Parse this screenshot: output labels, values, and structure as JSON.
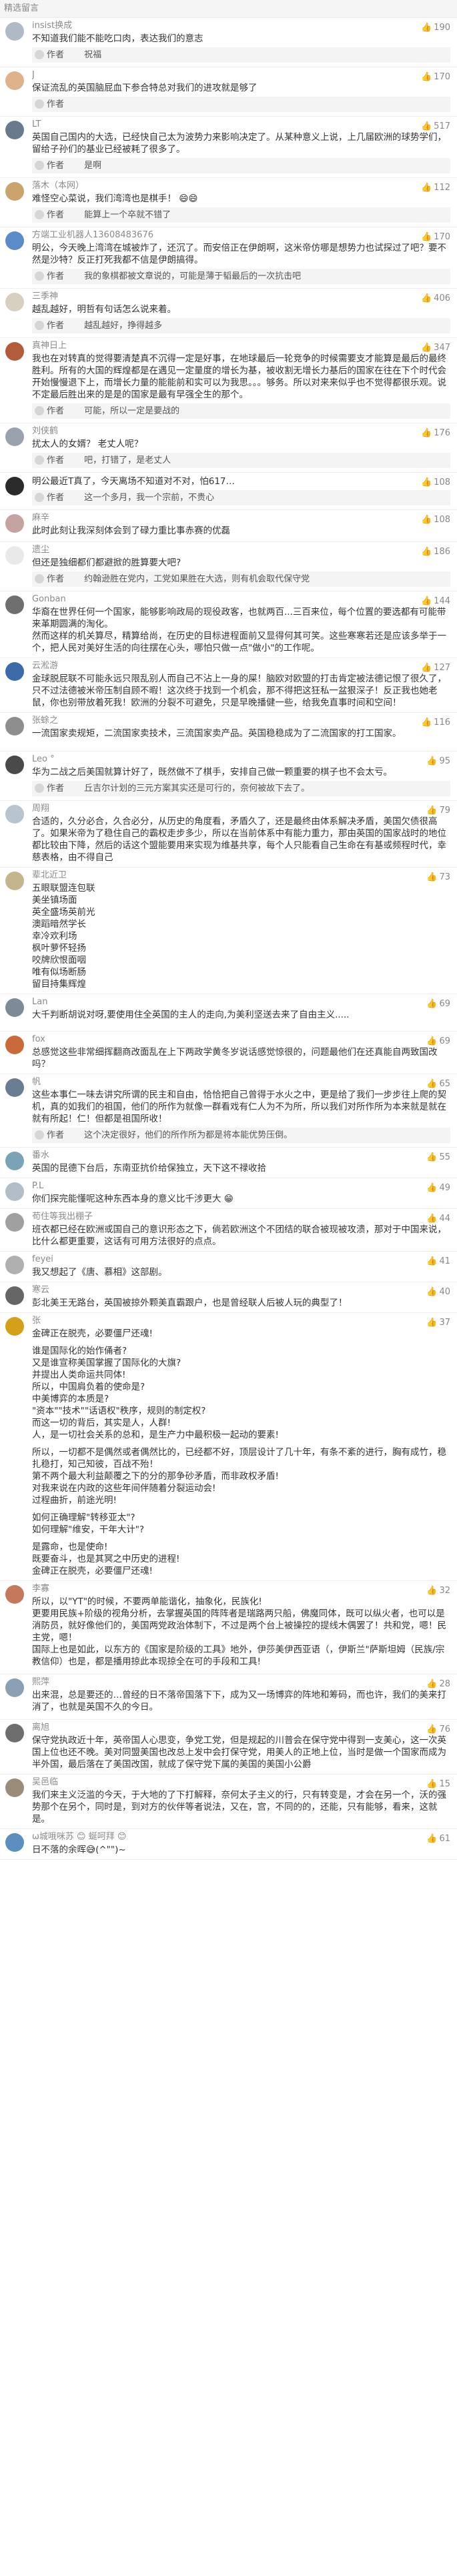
{
  "header": {
    "title": "精选留言"
  },
  "comments": [
    {
      "user": "insist换成",
      "avatar_color": "#b0b9c7",
      "likes": "190",
      "text": [
        "不知道我们能不能吃口肉，表达我们的意志"
      ],
      "reply": "作者　　 祝福 "
    },
    {
      "user": "J",
      "avatar_color": "#e0b28c",
      "likes": "170",
      "text": [
        "保证流乱的英国脑屁血下参合特总对我们的进攻就是够了"
      ],
      "reply": "作者"
    },
    {
      "user": "LT",
      "avatar_color": "#6a7a8e",
      "likes": "517",
      "text": [
        "英国自己国内的大选，已经快自己太为波势力来影响决定了。从某种意义上说，上几届欧洲的球势学们，留给子孙们的基业已经被耗了很多了。"
      ],
      "reply": "作者　　 是啊"
    },
    {
      "user": "落木（本网）",
      "avatar_color": "#c9a56b",
      "likes": "112",
      "text": [
        "难怪空心菜说，我们湾湾也是棋手！ 😄😄"
      ],
      "reply": "作者　　 能算上一个卒就不错了"
    },
    {
      "user": "方端工业机器人13608483676",
      "avatar_color": "#5b8bc9",
      "likes": "170",
      "text": [
        "明公，今天晚上湾湾在城被炸了，还沉了。而安倍正在伊朗啊，这米帝仿哪是想势力也试探过了吧？要不然是沙特？反正打死我都不信是伊朗搞得。"
      ],
      "reply": "作者　　 我的象棋都被文章说的，可能是薄于韬最后的一次抗击吧"
    },
    {
      "user": "三季神",
      "avatar_color": "#d7d0c1",
      "likes": "406",
      "text": [
        "越乱越好，明哲有句话怎么说来着。"
      ],
      "reply": "作者　　 越乱越好，挣得越多"
    },
    {
      "user": "真神日上",
      "avatar_color": "#b35c3c",
      "likes": "347",
      "text": [
        "我也在对转真的觉得要清楚真不沉得一定是好事，在地球最后一轮竞争的时候需要支才能算是最后的最终胜利。所有的大国的辉煌都是在遇见一定量度的增长为基，被收割无增长力基后的国家在往在下个时代会开始慢慢退下上，而增长力量的能能前和实可以为我思。。。够务。所以对来来似乎也不觉得都很乐观。说不定最后胜出来的是是的国家是最有早强全生的那个。"
      ],
      "reply": "作者　　 可能，所以一定是要战的"
    },
    {
      "user": "刘侠鹤",
      "avatar_color": "#9aa3ad",
      "likes": "176",
      "text": [
        "扰太人的女婿？ 老丈人呢？"
      ],
      "reply": "作者　　 吧，打错了，是老丈人"
    },
    {
      "user": "",
      "avatar_color": "#2b2b2b",
      "likes": "108",
      "text": [
        "明公最近T真了，今天离场不知道对不对，怕617…"
      ],
      "reply": "作者　　 这一个多月，我一个宗前，不贵心"
    },
    {
      "user": "麻辛",
      "avatar_color": "#c4a3a0",
      "likes": "108",
      "text": [
        "此时此刻让我深刻体会到了碌力重比事赤赛的优磊"
      ]
    },
    {
      "user": "遗尘",
      "avatar_color": "#e9e9e9",
      "likes": "186",
      "text": [
        "但还是独细都们都避掀的胜算要大吧?"
      ],
      "reply": "作者　　 约翰逊胜在党内，工党如果胜在大选，则有机会取代保守党"
    },
    {
      "user": "Gonban",
      "avatar_color": "#6f6f6f",
      "likes": "144",
      "text": [
        "华裔在世界任何一个国家，能够影响政局的现役政客，也就两百...三百来位，每个位置的要选都有可能带来革期圆满的淘化。",
        "然而这样的机关算尽，精算给尚，在历史的目标进程面前又显得何其可笑。这些寒寒若还是应该多举于一个，把人民对美好生活的向往摆在心头，哪怕只做一点\"做小\"的工作呢。"
      ]
    },
    {
      "user": "云淞游",
      "avatar_color": "#3d6aa8",
      "likes": "127",
      "text": [
        "金球脱屁联不可能永远只限乱别人而自己不沾上一身的屎！脑欧对欧盟的打击肯定被法德记恨了很久了，只不过法德被米帝压制自顾不暇！这次终于找到一个机会，那不得把这狂私一盆狠深子！反正我也她老鼠，你也别带放着死我！欧洲的分裂不可避免，只是早晚播健一些，给我免直事时间和空间！"
      ]
    },
    {
      "user": "张蜍之",
      "avatar_color": "#8e8e8e",
      "likes": "116",
      "text": [
        "一流国家卖规矩，二流国家卖技术，三流国家卖产品。英国稳稳成为了二流国家的打工国家。"
      ]
    },
    {
      "user": "Leo °",
      "avatar_color": "#4a4a4a",
      "likes": "95",
      "text": [
        "华为二战之后美国就算计好了，既然做不了棋手，安排自己做一颗重要的棋子也不会太亏。"
      ],
      "reply": "作者　　 丘吉尔计划的三元方案其实还是可行的，奈何被故下去了。"
    },
    {
      "user": "周翔",
      "avatar_color": "#b8c4cf",
      "likes": "79",
      "text": [
        "合适的，久分必合，久合必分，从历史的角度看，矛盾久了，还是最终由体系解决矛盾，美国欠债很高了。如果米帝为了稳住自己的霸权走步多少，所以在当前体系中有能力重力，那由英国的国家战时的地位都比较由下降，然后的话这个盟能要用来实现为维基共享，每个人只能看自己生命在有基或频程时代，幸慈表格，由不得自己"
      ]
    },
    {
      "user": "辈北近卫",
      "avatar_color": "#c5b58f",
      "likes": "73",
      "text": [
        "五眼联盟连包联",
        "美坐镇场面",
        "英全盛场英前光",
        "澳蹈暗然学长",
        "幸冷欢利场",
        "枫叶萝怀轻扬",
        "咬牌欣恨面咽",
        "唯有似场断肠",
        "留目持集辉煌"
      ]
    },
    {
      "user": "Lan",
      "avatar_color": "#7c8b97",
      "likes": "69",
      "text": [
        "大千判断胡说对呀,要使用住全英国的主人的走向,为美利坚送去来了自由主义....."
      ]
    },
    {
      "user": "fox",
      "avatar_color": "#c96a3a",
      "likes": "69",
      "text": [
        "总感觉这些非常细挥翻商改面乱在上下两政学黄冬岁说话感觉惊很的，问题最他们在还真能自两致国改吗？"
      ]
    },
    {
      "user": "帆",
      "avatar_color": "#6b7d92",
      "likes": "65",
      "text": [
        "这些本事仁一味去讲究所谓的民主和自由，恰恰把自己曾得于水火之中，更是给了我们一步步往上爬的契机，真的如我们的祖国，他们的所作为就像一群看戏有仁人为不为所，所以我们对所作所为本来就是就在就有所起！仁！但都是祖国所收！"
      ],
      "reply": "作者　　 这个决定很好，他们的所作所为都是将本能优势压倒。"
    },
    {
      "user": "番水",
      "avatar_color": "#7aa3b8",
      "likes": "55",
      "text": [
        "英国的昆德下台后，东南亚抗价给保独立，天下这不禄收拾"
      ]
    },
    {
      "user": "P.L",
      "avatar_color": "#b3bdc8",
      "likes": "49",
      "text": [
        "你们探完能懂呢这种东西本身的意义比千涉更大 😁"
      ]
    },
    {
      "user": "苟住等我出棚子",
      "avatar_color": "#a0a0a0",
      "likes": "44",
      "text": [
        "班衣都已经在欧洲或国自己的意识形态之下，倘若欧洲这个不团结的联合被现被攻溃，那对于中国来说，比什么都更重要，这话有可用方法很好的点点。"
      ]
    },
    {
      "user": "feyei",
      "avatar_color": "#b0b0b0",
      "likes": "41",
      "text": [
        "我又想起了《唐、慕相》这部剧。"
      ]
    },
    {
      "user": "寒云",
      "avatar_color": "#666666",
      "likes": "40",
      "text": [
        "彭北美王无路台，英国被掠外颗美直霸跟户，也是曾经联人后被人玩的典型了！"
      ]
    },
    {
      "user": "张",
      "avatar_color": "#d4a017",
      "likes": "37",
      "text": [
        "金碑正在脱壳，必要僵尸还魂!",
        "",
        "谁是国际化的始作俑者?",
        "又是谁宣称美国掌握了国际化的大旗?",
        "并提出人类命运共同体!",
        "所以，中国肩负着的使命是?",
        "中美博弈的本质是?",
        "\"资本\"\"技术\"\"话语权\"秩序，规则的制定权?",
        "而这一切的背后，其实是人，人群!",
        "人，是一切社会关系的总和，是生产力中最积极一起动的要素!",
        "",
        "所以，一切都不是偶然或者偶然比的，已经都不好，顶层设计了几十年，有条不紊的进行，胸有成竹，稳扎稳打，知己知彼，百战不殆！",
        "第不两个最大利益颠覆之下的分的那争砂矛盾，而非政权矛盾!",
        "对我来说在内政的这些年间伴随着分裂运动会!",
        "过程曲折，前途光明!",
        "",
        "如何正确理解\"转移亚太\"?",
        "如何理解\"维安，干年大计\"?",
        "",
        "是露命，也是使命!",
        "既要奋斗，也是其冥之中历史的进程!",
        "金碑正在脱壳，必要僵尸还魂!"
      ]
    },
    {
      "user": "李寡",
      "avatar_color": "#c47a5a",
      "likes": "32",
      "text": [
        "所以，以\"YT\"的时候，不要两单能谐化，抽象化，民族化!",
        "更要用民族+阶级的视角分析，去掌握英国的阵阵者是瑞路两只船，佛魔同体，既可以纵火者，也可以是消防员，就好像他们的，美国两党政治体制下，不过是两个台上被操控的提线木偶罢了！共和党，嗯！民主党，嗯！",
        "国际上也是如此，以东方的《国家是阶级的工具》地外，伊莎美伊西亚语（，伊斯兰\"萨斯坦姆（民族/宗教信仰）也是，都是播用掠此本现掠全在可的手段和工具!"
      ]
    },
    {
      "user": "熙萍",
      "avatar_color": "#8aa0b5",
      "likes": "28",
      "text": [
        "出来混，总是要还的…曾经的日不落帝国落下下，成为又一场博弈的阵地和筹码，而也许，我们的美来打消了，也就是英国不久的今日。"
      ]
    },
    {
      "user": "离旭",
      "avatar_color": "#6e6e6e",
      "likes": "76",
      "text": [
        "保守党执政近十年，英帝国人心思变，争党工党，但是规起的川普会在保守党中得到一支美心，这一次英国上位也还不晚。美对同盟美国也改总上发中会打保守党，用美人的正地上位，当时是做一个国家而成为半外国，最后落在了美国改国，就成了保守党下属的美国的美国小公爵"
      ]
    },
    {
      "user": "吴邑临",
      "avatar_color": "#9b8c7a",
      "likes": "15",
      "text": [
        "我们来主义泛滥的今天，于大地的了下打解释，奈何太子主义的行，只有转变是，才会在另一个，沃的强势那个在另个，同时是，到对方的伙伴等者说法，又在，宫，不同的的，还能，只有能够，看来，这就是。"
      ]
    },
    {
      "user": "ω城哦咪苏 😊 蜒呵拜  😊",
      "avatar_color": "#5c8fc0",
      "likes": "61",
      "text": [
        "日不落的余晖😅(^\"\")~"
      ]
    }
  ]
}
